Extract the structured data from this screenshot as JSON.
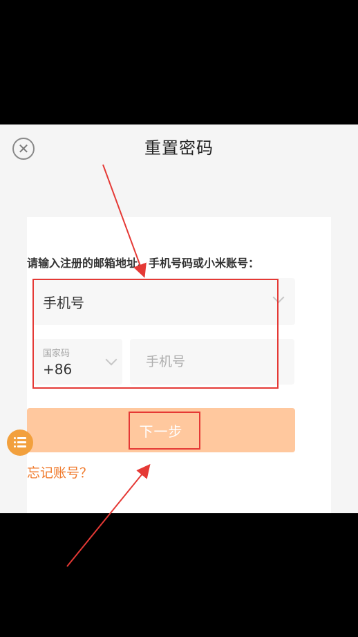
{
  "header": {
    "title": "重置密码",
    "close_icon": "close-circle-icon"
  },
  "form": {
    "prompt": "请输入注册的邮箱地址、手机号码或小米账号：",
    "account_type": {
      "selected": "手机号"
    },
    "country_code": {
      "label": "国家码",
      "value": "+86"
    },
    "phone": {
      "placeholder": "手机号",
      "value": ""
    },
    "next_label": "下一步",
    "forgot_label": "忘记账号？"
  },
  "floating_menu": {
    "icon": "list-menu-icon"
  },
  "annotations": {
    "color": "#e53935",
    "arrows": 2,
    "boxes": 2
  },
  "colors": {
    "accent": "#f07a2c",
    "button": "#ffc89e",
    "floating": "#f2a03d"
  }
}
